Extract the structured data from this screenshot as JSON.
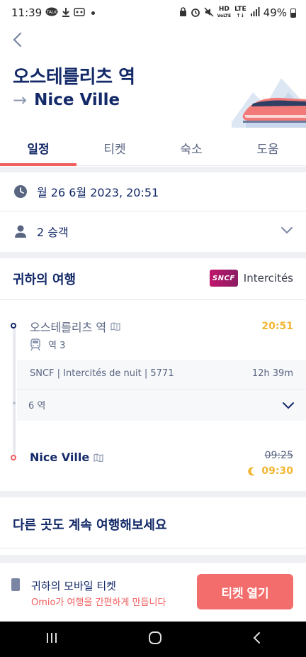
{
  "status_bar": {
    "time": "11:39",
    "battery": "49%",
    "left_icons": [
      "talk-icon",
      "download-icon",
      "ev-icon"
    ],
    "right_icons": [
      "lock-icon",
      "alarm-icon",
      "mute-icon",
      "hd-voice-icon",
      "lte-icon",
      "signal-icon",
      "battery-icon"
    ],
    "hd_label": "HD",
    "lte_label": "LTE"
  },
  "header": {
    "origin": "오스테를리츠 역",
    "arrow": "→",
    "destination": "Nice Ville"
  },
  "tabs": [
    {
      "label": "일정",
      "active": true
    },
    {
      "label": "티켓",
      "active": false
    },
    {
      "label": "숙소",
      "active": false
    },
    {
      "label": "도움",
      "active": false
    }
  ],
  "datetime": "월 26 6월 2023, 20:51",
  "passengers": "2 승객",
  "journey": {
    "title": "귀하의 여행",
    "operator_logo": "SNCF",
    "operator_name": "Intercités",
    "departure": {
      "station": "오스테를리츠 역",
      "platform": "역 3",
      "time": "20:51"
    },
    "train_info": "SNCF | Intercités de nuit | 5771",
    "duration": "12h 39m",
    "stops": "6 역",
    "arrival": {
      "station": "Nice Ville",
      "scheduled_time": "09:25",
      "actual_time": "09:30"
    }
  },
  "explore": {
    "title": "다른 곳도 계속 여행해보세요"
  },
  "bottom_bar": {
    "title": "귀하의 모바일 티켓",
    "subtitle": "Omio가 여행을 간편하게 만듭니다",
    "button": "티켓 열기"
  },
  "colors": {
    "navy": "#132968",
    "accent_red": "#f0605f",
    "time_yellow": "#f2b631",
    "muted": "#5a6582"
  }
}
